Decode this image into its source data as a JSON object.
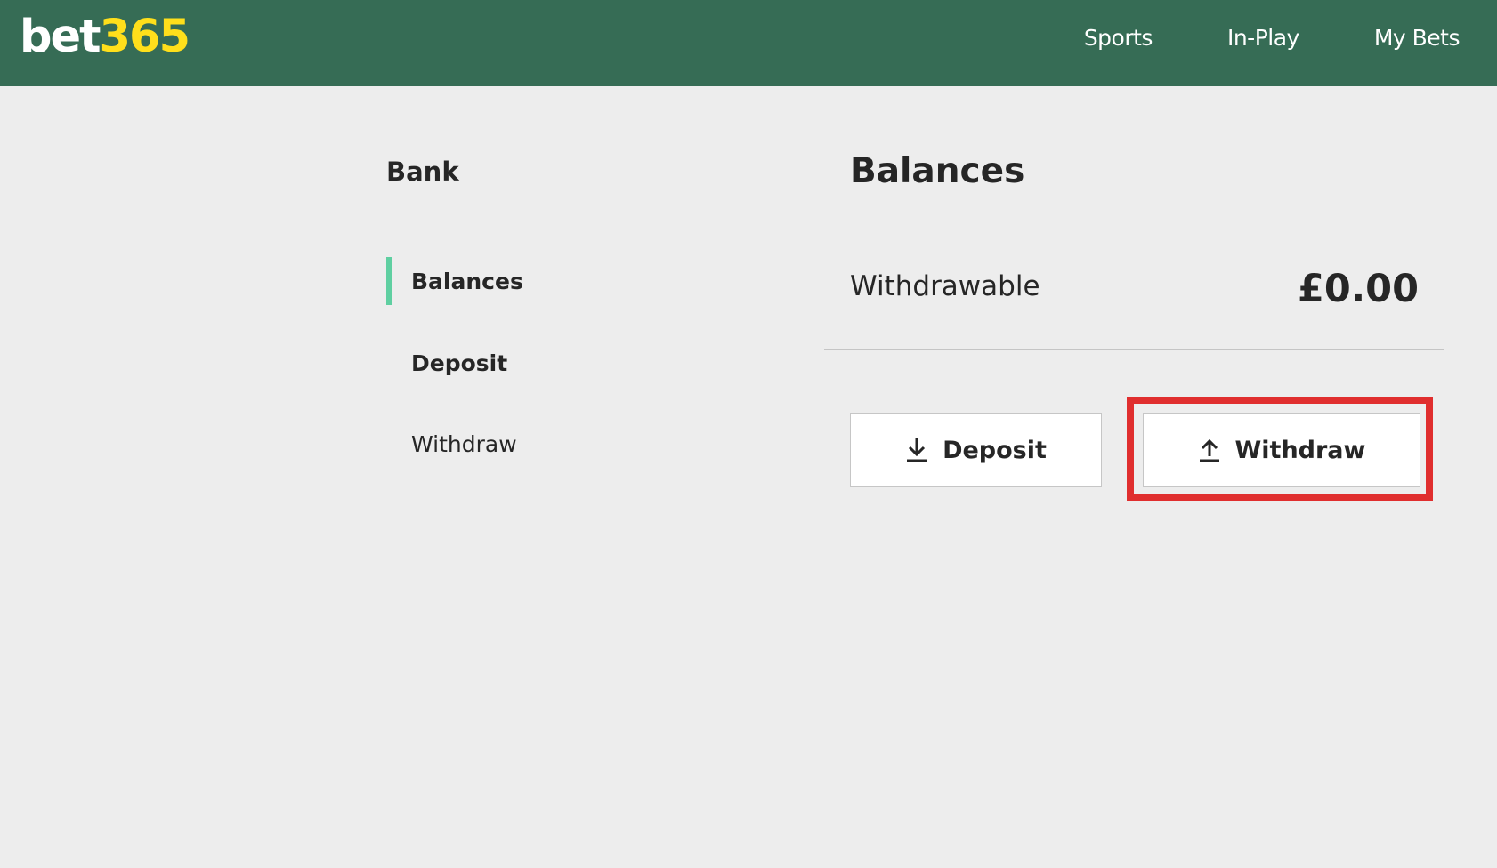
{
  "header": {
    "logo_part1": "bet",
    "logo_part2": "365",
    "nav": [
      "Sports",
      "In-Play",
      "My Bets"
    ]
  },
  "sidebar": {
    "heading": "Bank",
    "items": [
      {
        "label": "Balances"
      },
      {
        "label": "Deposit"
      },
      {
        "label": "Withdraw"
      }
    ]
  },
  "main": {
    "title": "Balances",
    "balance_label": "Withdrawable",
    "balance_value": "£0.00",
    "deposit_button": "Deposit",
    "withdraw_button": "Withdraw"
  },
  "icons": {
    "deposit": "download-icon",
    "withdraw": "upload-icon"
  },
  "colors": {
    "header_bg": "#366c55",
    "logo_accent": "#ffdf1b",
    "active_indicator": "#5fcfa1",
    "highlight": "#e02e2e",
    "page_bg": "#ededed"
  }
}
